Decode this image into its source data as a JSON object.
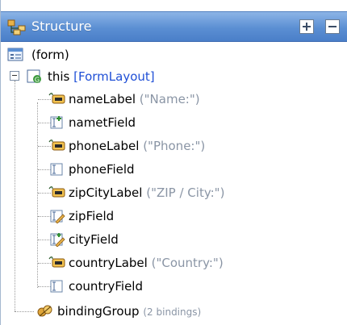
{
  "panel": {
    "title": "Structure",
    "expand_all_icon": "expand-all-icon",
    "collapse_all_icon": "collapse-all-icon"
  },
  "tree": {
    "root": {
      "label": "(form)",
      "icon": "form-icon"
    },
    "this": {
      "label": "this",
      "type": "[FormLayout]",
      "icon": "panel-icon"
    },
    "children": [
      {
        "name": "nameLabel",
        "hint": "(\"Name:\")",
        "icon": "label-icon"
      },
      {
        "name": "nametField",
        "hint": "",
        "icon": "textfield-bound-icon"
      },
      {
        "name": "phoneLabel",
        "hint": "(\"Phone:\")",
        "icon": "label-icon"
      },
      {
        "name": "phoneField",
        "hint": "",
        "icon": "textfield-icon"
      },
      {
        "name": "zipCityLabel",
        "hint": "(\"ZIP / City:\")",
        "icon": "label-icon"
      },
      {
        "name": "zipField",
        "hint": "",
        "icon": "textfield-edit-icon"
      },
      {
        "name": "cityField",
        "hint": "",
        "icon": "textfield-bound-edit-icon"
      },
      {
        "name": "countryLabel",
        "hint": "(\"Country:\")",
        "icon": "label-icon"
      },
      {
        "name": "countryField",
        "hint": "",
        "icon": "textfield-icon"
      }
    ],
    "binding": {
      "name": "bindingGroup",
      "hint": "(2 bindings)",
      "icon": "binding-group-icon"
    }
  },
  "colors": {
    "title_bar": "#5b8fd3",
    "type_text": "#1f4fd6",
    "hint_text": "#8a95a5"
  }
}
